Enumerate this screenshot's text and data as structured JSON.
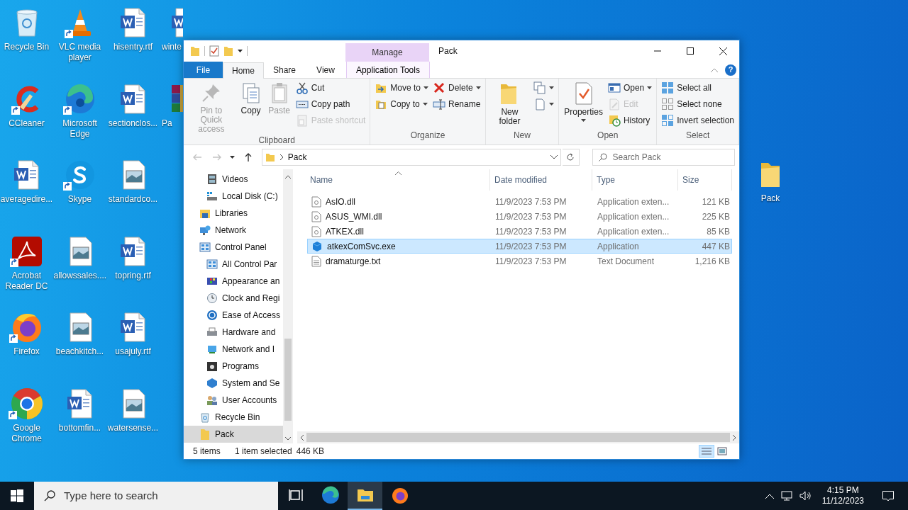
{
  "desktop": {
    "rows": [
      [
        {
          "label": "Recycle Bin",
          "kind": "recycle",
          "shortcut": false
        },
        {
          "label": "VLC media player",
          "kind": "vlc",
          "shortcut": true
        },
        {
          "label": "hisentry.rtf",
          "kind": "word",
          "shortcut": false
        },
        {
          "label": "winte",
          "kind": "word",
          "shortcut": false
        }
      ],
      [
        {
          "label": "CCleaner",
          "kind": "ccleaner",
          "shortcut": true
        },
        {
          "label": "Microsoft Edge",
          "kind": "edge",
          "shortcut": true
        },
        {
          "label": "sectionclos...",
          "kind": "word",
          "shortcut": false
        },
        {
          "label": "Pa",
          "kind": "winrar",
          "shortcut": false
        }
      ],
      [
        {
          "label": "averagedire...",
          "kind": "word",
          "shortcut": false
        },
        {
          "label": "Skype",
          "kind": "skype",
          "shortcut": true
        },
        {
          "label": "standardco...",
          "kind": "image",
          "shortcut": false
        }
      ],
      [
        {
          "label": "Acrobat Reader DC",
          "kind": "acrobat",
          "shortcut": true
        },
        {
          "label": "allowssales....",
          "kind": "image",
          "shortcut": false
        },
        {
          "label": "topring.rtf",
          "kind": "word",
          "shortcut": false
        }
      ],
      [
        {
          "label": "Firefox",
          "kind": "firefox",
          "shortcut": true
        },
        {
          "label": "beachkitch...",
          "kind": "image",
          "shortcut": false
        },
        {
          "label": "usajuly.rtf",
          "kind": "word",
          "shortcut": false
        }
      ],
      [
        {
          "label": "Google Chrome",
          "kind": "chrome",
          "shortcut": true
        },
        {
          "label": "bottomfin...",
          "kind": "word",
          "shortcut": false
        },
        {
          "label": "watersense...",
          "kind": "image",
          "shortcut": false
        }
      ]
    ],
    "side_icons": [
      {
        "label": "Pack",
        "kind": "folder",
        "shortcut": false
      }
    ]
  },
  "explorer": {
    "title": "Pack",
    "contextual_label": "Manage",
    "tabs": [
      {
        "label": "File",
        "kind": "file",
        "selected": false
      },
      {
        "label": "Home",
        "kind": "normal",
        "selected": true
      },
      {
        "label": "Share",
        "kind": "normal",
        "selected": false
      },
      {
        "label": "View",
        "kind": "normal",
        "selected": false
      },
      {
        "label": "Application Tools",
        "kind": "contextual",
        "selected": false
      }
    ],
    "help": "?",
    "ribbon": [
      {
        "label": "Clipboard",
        "columns": [
          {
            "buttons": [
              {
                "label": "Pin to Quick access",
                "kind": "pin",
                "disabled": true,
                "menu": false
              }
            ]
          },
          {
            "buttons": [
              {
                "label": "Copy",
                "kind": "copy",
                "disabled": false,
                "menu": false
              }
            ]
          },
          {
            "buttons": [
              {
                "label": "Paste",
                "kind": "paste",
                "disabled": true,
                "menu": false
              }
            ]
          },
          {
            "buttons": [
              {
                "label": "Cut",
                "kind": "cut",
                "disabled": false,
                "menu": false
              },
              {
                "label": "Copy path",
                "kind": "copypath",
                "disabled": false,
                "menu": false
              },
              {
                "label": "Paste shortcut",
                "kind": "shortcut",
                "disabled": true,
                "menu": false
              }
            ]
          }
        ]
      },
      {
        "label": "Organize",
        "columns": [
          {
            "buttons": [
              {
                "label": "Move to",
                "kind": "move",
                "disabled": false,
                "menu": true
              },
              {
                "label": "Copy to",
                "kind": "copyto",
                "disabled": false,
                "menu": true
              }
            ]
          },
          {
            "buttons": [
              {
                "label": "Delete",
                "kind": "delete",
                "disabled": false,
                "menu": true
              },
              {
                "label": "Rename",
                "kind": "rename",
                "disabled": false,
                "menu": false
              }
            ]
          }
        ]
      },
      {
        "label": "New",
        "columns": [
          {
            "buttons": [
              {
                "label": "New folder",
                "kind": "folder",
                "disabled": false,
                "menu": false
              }
            ]
          },
          {
            "buttons": [
              {
                "kind": "newitem",
                "disabled": false,
                "menu": true
              },
              {
                "kind": "easyaccess",
                "disabled": false,
                "menu": true
              }
            ]
          }
        ]
      },
      {
        "label": "Open",
        "columns": [
          {
            "buttons": [
              {
                "label": "Properties",
                "kind": "properties",
                "disabled": false,
                "menu": true
              }
            ]
          },
          {
            "buttons": [
              {
                "label": "Open",
                "kind": "open",
                "disabled": false,
                "menu": true
              },
              {
                "label": "Edit",
                "kind": "edit",
                "disabled": true,
                "menu": false
              },
              {
                "label": "History",
                "kind": "history",
                "disabled": false,
                "menu": false
              }
            ]
          }
        ]
      },
      {
        "label": "Select",
        "columns": [
          {
            "buttons": [
              {
                "label": "Select all",
                "kind": "selectall",
                "disabled": false,
                "menu": false
              },
              {
                "label": "Select none",
                "kind": "selectnone",
                "disabled": false,
                "menu": false
              },
              {
                "label": "Invert selection",
                "kind": "invert",
                "disabled": false,
                "menu": false
              }
            ]
          }
        ]
      }
    ],
    "nav_buttons": [
      {
        "kind": "back",
        "disabled": true
      },
      {
        "kind": "forward",
        "disabled": true
      },
      {
        "kind": "recent",
        "disabled": false
      },
      {
        "kind": "up",
        "disabled": false
      }
    ],
    "address": {
      "path": "Pack"
    },
    "search": {
      "placeholder": "Search Pack"
    },
    "nav": [
      {
        "kind": "group",
        "children": [
          {
            "label": "Videos",
            "kind": "videos",
            "selected": false
          },
          {
            "label": "Local Disk (C:)",
            "kind": "disk",
            "selected": false
          }
        ]
      },
      {
        "label": "Libraries",
        "kind": "libraries",
        "selected": false
      },
      {
        "label": "Network",
        "kind": "network",
        "selected": false
      },
      {
        "label": "Control Panel",
        "kind": "control",
        "selected": false,
        "children": [
          {
            "label": "All Control Par",
            "kind": "control",
            "selected": false
          },
          {
            "label": "Appearance an",
            "kind": "appearance",
            "selected": false
          },
          {
            "label": "Clock and Regi",
            "kind": "clock",
            "selected": false
          },
          {
            "label": "Ease of Access",
            "kind": "ease",
            "selected": false
          },
          {
            "label": "Hardware and",
            "kind": "hardware",
            "selected": false
          },
          {
            "label": "Network and I",
            "kind": "netcpl",
            "selected": false
          },
          {
            "label": "Programs",
            "kind": "programs",
            "selected": false
          },
          {
            "label": "System and Se",
            "kind": "system",
            "selected": false
          },
          {
            "label": "User Accounts",
            "kind": "users",
            "selected": false
          }
        ]
      },
      {
        "label": "Recycle Bin",
        "kind": "recycle",
        "selected": false
      },
      {
        "label": "Pack",
        "kind": "folder",
        "selected": true
      }
    ],
    "columns": [
      "Name",
      "Date modified",
      "Type",
      "Size"
    ],
    "files": [
      {
        "name": "AsIO.dll",
        "date": "11/9/2023 7:53 PM",
        "type": "Application exten...",
        "size": "121 KB",
        "kind": "dll",
        "selected": false
      },
      {
        "name": "ASUS_WMI.dll",
        "date": "11/9/2023 7:53 PM",
        "type": "Application exten...",
        "size": "225 KB",
        "kind": "dll",
        "selected": false
      },
      {
        "name": "ATKEX.dll",
        "date": "11/9/2023 7:53 PM",
        "type": "Application exten...",
        "size": "85 KB",
        "kind": "dll",
        "selected": false
      },
      {
        "name": "atkexComSvc.exe",
        "date": "11/9/2023 7:53 PM",
        "type": "Application",
        "size": "447 KB",
        "kind": "exe",
        "selected": true
      },
      {
        "name": "dramaturge.txt",
        "date": "11/9/2023 7:53 PM",
        "type": "Text Document",
        "size": "1,216 KB",
        "kind": "txt",
        "selected": false
      }
    ],
    "status": {
      "count": "5 items",
      "selection": "1 item selected",
      "size": "446 KB",
      "views": [
        {
          "kind": "details",
          "selected": true
        },
        {
          "kind": "large",
          "selected": false
        }
      ]
    }
  },
  "taskbar": {
    "search_placeholder": "Type here to search",
    "apps": [
      {
        "kind": "taskview",
        "active": false
      },
      {
        "kind": "edge",
        "active": false
      },
      {
        "kind": "explorer",
        "active": true
      },
      {
        "kind": "firefox",
        "active": false
      }
    ],
    "time": "4:15 PM",
    "date": "11/12/2023"
  }
}
